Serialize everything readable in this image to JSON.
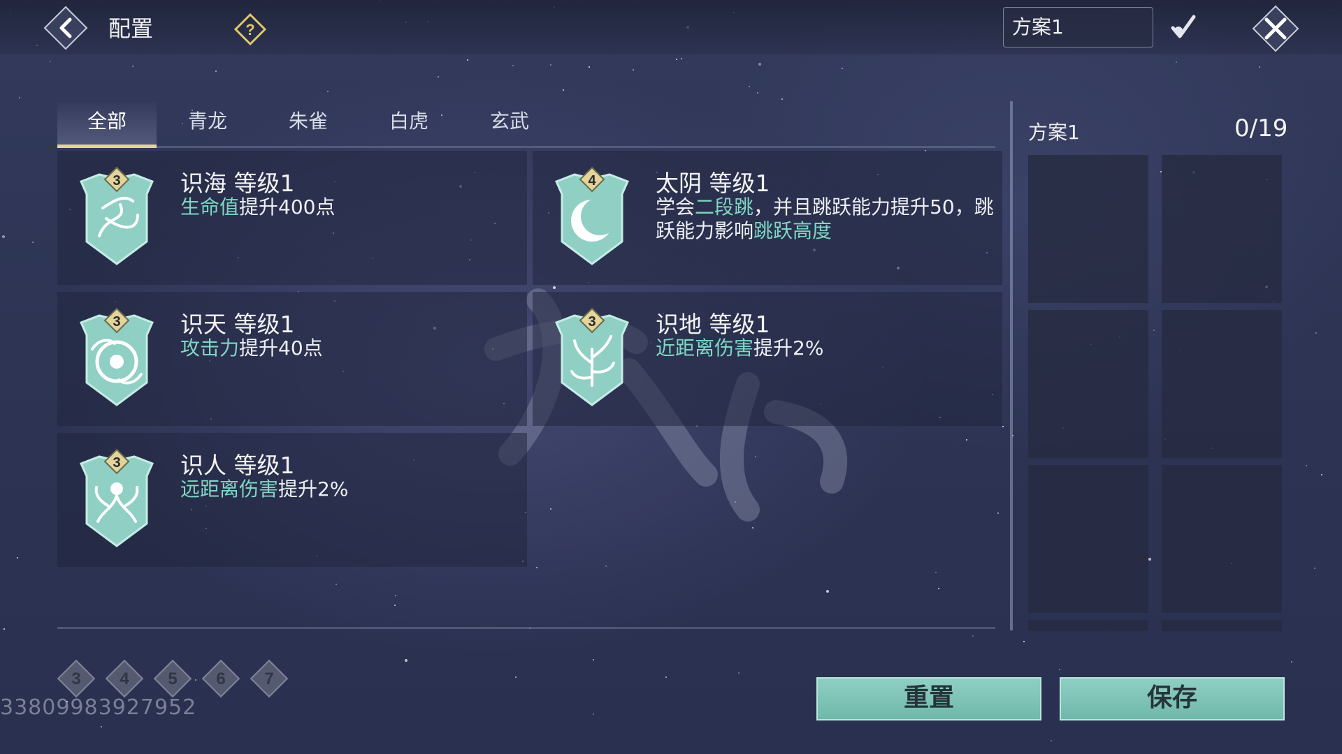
{
  "header": {
    "title": "配置",
    "scheme_selected": "方案1"
  },
  "tabs": [
    {
      "label": "全部",
      "active": true
    },
    {
      "label": "青龙",
      "active": false
    },
    {
      "label": "朱雀",
      "active": false
    },
    {
      "label": "白虎",
      "active": false
    },
    {
      "label": "玄武",
      "active": false
    }
  ],
  "skills": [
    {
      "name": "识海",
      "level_text": "等级1",
      "cost": "3",
      "desc_highlight": "生命值",
      "desc_rest": "提升400点",
      "icon": "sea-swirl-icon"
    },
    {
      "name": "太阴",
      "level_text": "等级1",
      "cost": "4",
      "desc_pre": "学会",
      "desc_highlight": "二段跳",
      "desc_mid": "，并且跳跃能力提升50，跳跃能力影响",
      "desc_highlight2": "跳跃高度",
      "icon": "crescent-moon-icon"
    },
    {
      "name": "识天",
      "level_text": "等级1",
      "cost": "3",
      "desc_highlight": "攻击力",
      "desc_rest": "提升40点",
      "icon": "sky-eye-icon"
    },
    {
      "name": "识地",
      "level_text": "等级1",
      "cost": "3",
      "desc_highlight": "近距离伤害",
      "desc_rest": "提升2%",
      "icon": "earth-tree-icon"
    },
    {
      "name": "识人",
      "level_text": "等级1",
      "cost": "3",
      "desc_highlight": "远距离伤害",
      "desc_rest": "提升2%",
      "icon": "human-spirit-icon"
    }
  ],
  "panel": {
    "scheme_name": "方案1",
    "count": "0/19"
  },
  "level_filters": [
    "3",
    "4",
    "5",
    "6",
    "7"
  ],
  "uid": "33809983927952",
  "buttons": {
    "reset": "重置",
    "save": "保存"
  },
  "colors": {
    "highlight": "#7fd7c4",
    "badge_gold": "#e2d49a",
    "button_teal": "#7fc4b8",
    "icon_teal": "#8fcfc4"
  }
}
